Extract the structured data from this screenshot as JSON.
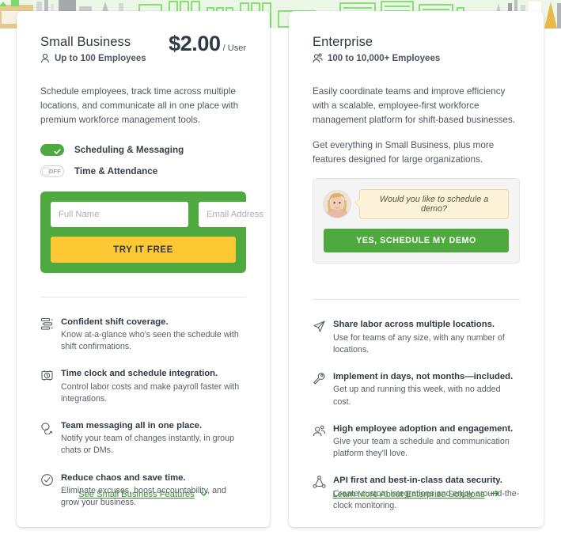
{
  "background": {
    "name": "cityscape-illustration",
    "base_color": "#ecf7e7",
    "accent_color": "#8ee57f"
  },
  "colors": {
    "brand_green": "#4ea93f",
    "cta_yellow": "#fcc934",
    "link_green": "#3d8b35",
    "heading": "#2f3a45",
    "body_text": "#5a6068",
    "bubble_bg": "#fdf3d9"
  },
  "small_business": {
    "plan_name": "Small Business",
    "employees": "Up to 100 Employees",
    "employees_icon": "user-icon",
    "price_amount": "$2.00",
    "price_unit": "/ User",
    "description": "Schedule employees, track time across multiple locations, and communicate all in one place with premium workforce management tools.",
    "toggles": [
      {
        "label": "Scheduling & Messaging",
        "state": "on",
        "off_text": ""
      },
      {
        "label": "Time & Attendance",
        "state": "off",
        "off_text": "OFF"
      }
    ],
    "form": {
      "name_placeholder": "Full Name",
      "name_value": "",
      "email_placeholder": "Email Address",
      "email_value": "",
      "submit_label": "TRY IT FREE"
    },
    "features": [
      {
        "icon": "shift-coverage-icon",
        "title": "Confident shift coverage.",
        "desc": "Know at-a-glance who's seen the schedule with shift confirmations."
      },
      {
        "icon": "time-clock-icon",
        "title": "Time clock and schedule integration.",
        "desc": "Control labor costs and make payroll faster with integrations."
      },
      {
        "icon": "chat-bubbles-icon",
        "title": "Team messaging all in one place.",
        "desc": "Notify your team of changes instantly, in group chats or DMs."
      },
      {
        "icon": "check-circle-icon",
        "title": "Reduce chaos and save time.",
        "desc": "Eliminate excuses, boost accountability, and grow your business."
      }
    ],
    "footer_link": "See Small Business Features",
    "footer_link_icon": "chevron-down-icon"
  },
  "enterprise": {
    "plan_name": "Enterprise",
    "employees": "100 to 10,000+ Employees",
    "employees_icon": "users-group-icon",
    "description_1": "Easily coordinate teams and improve efficiency with a scalable, employee-first workforce management platform for shift-based businesses.",
    "description_2": "Get everything in Small Business, plus more features designed for large organizations.",
    "demo": {
      "avatar_icon": "agent-avatar",
      "bubble_text": "Would you like to schedule a demo?",
      "button_label": "YES, SCHEDULE MY DEMO"
    },
    "features": [
      {
        "icon": "paper-plane-icon",
        "title": "Share labor across multiple locations.",
        "desc": "Use for teams of any size, with any number of locations."
      },
      {
        "icon": "wrench-icon",
        "title": "Implement in days, not months—included.",
        "desc": "Get up and running this week, with no added cost."
      },
      {
        "icon": "people-group-icon",
        "title": "High employee adoption and engagement.",
        "desc": "Give your team a schedule and communication platform they'll love."
      },
      {
        "icon": "network-nodes-icon",
        "title": "API first and best-in-class data security.",
        "desc": "Create custom integrations and enjoy around-the-clock monitoring."
      }
    ],
    "footer_link": "Learn More About Enterprise Solutions",
    "footer_link_icon": "arrow-right-icon"
  }
}
